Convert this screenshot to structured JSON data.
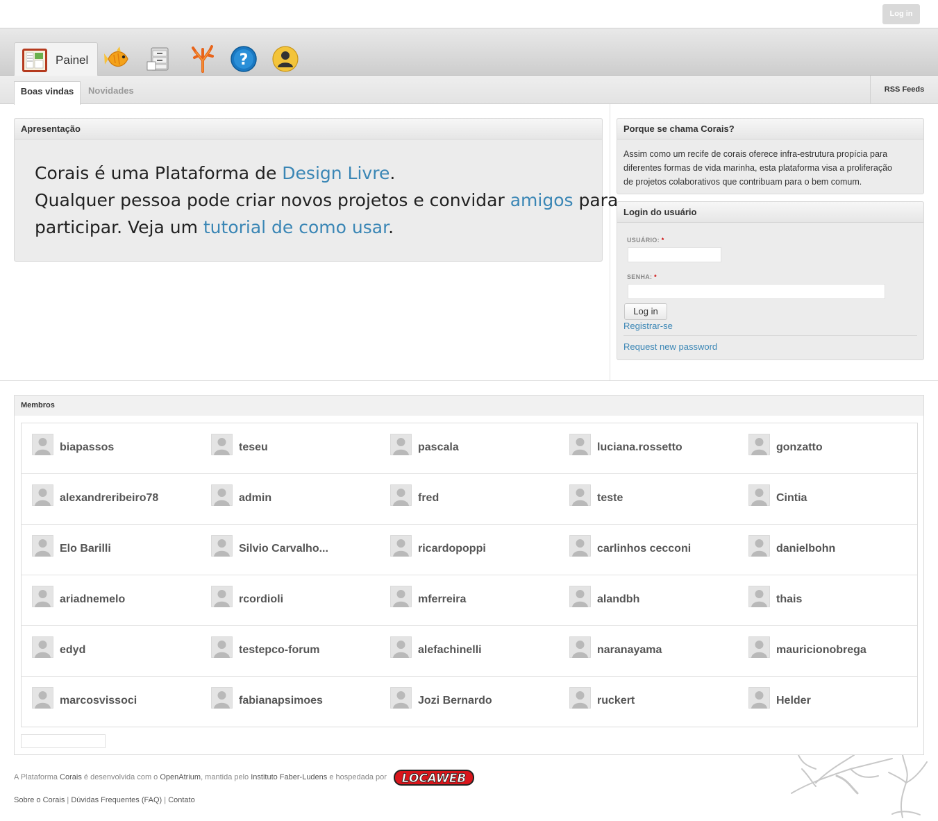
{
  "header": {
    "login_label": "Log in"
  },
  "nav": {
    "active_tab_label": "Painel",
    "icons": [
      "painel-icon",
      "fish-icon",
      "files-icon",
      "coral-icon",
      "help-icon",
      "user-icon"
    ]
  },
  "subtabs": {
    "active": "Boas vindas",
    "other": "Novidades",
    "rss": "RSS Feeds"
  },
  "apresentacao": {
    "title": "Apresentação",
    "l1_a": "Corais é uma Plataforma de ",
    "l1_link": "Design Livre",
    "l1_b": ".",
    "l2_a": "Qualquer pessoa pode criar novos projetos e convidar ",
    "l2_link": "amigos",
    "l2_b": " para",
    "l3_a": "participar. Veja um ",
    "l3_link": "tutorial de como usar",
    "l3_b": "."
  },
  "porque": {
    "title": "Porque se chama Corais?",
    "text_1": "Assim como um recife de corais oferece infra-estrutura propícia para",
    "text_2": "diferentes formas de vida marinha, esta plataforma visa a proliferação",
    "text_3": "de projetos colaborativos que contribuam para o bem comum."
  },
  "login": {
    "title": "Login do usuário",
    "username_label": "USUÁRIO:",
    "password_label": "SENHA:",
    "required_mark": "*",
    "button": "Log in",
    "register": "Registrar-se",
    "request_password": "Request new password"
  },
  "membros": {
    "title": "Membros",
    "rows": [
      [
        "biapassos",
        "teseu",
        "pascala",
        "luciana.rossetto",
        "gonzatto"
      ],
      [
        "alexandreribeiro78",
        "admin",
        "fred",
        "teste",
        "Cintia"
      ],
      [
        "Elo Barilli",
        "Silvio Carvalho...",
        "ricardopoppi",
        "carlinhos cecconi",
        "danielbohn"
      ],
      [
        "ariadnemelo",
        "rcordioli",
        "mferreira",
        "alandbh",
        "thais"
      ],
      [
        "edyd",
        "testepco-forum",
        "alefachinelli",
        "naranayama",
        "mauricionobrega"
      ],
      [
        "marcosvissoci",
        "fabianapsimoes",
        "Jozi Bernardo",
        "ruckert",
        "Helder"
      ]
    ]
  },
  "footer": {
    "p1": "A Plataforma ",
    "corais": "Corais",
    "p2": " é desenvolvida com o ",
    "openatrium": "OpenAtrium",
    "p3": ", mantida pelo ",
    "instituto": "Instituto Faber-Ludens",
    "p4": " e hospedada por",
    "locaweb": "LOCAWEB",
    "links": [
      "Sobre o Corais",
      "Dúvidas Frequentes (FAQ)",
      "Contato"
    ],
    "sep": " | "
  }
}
